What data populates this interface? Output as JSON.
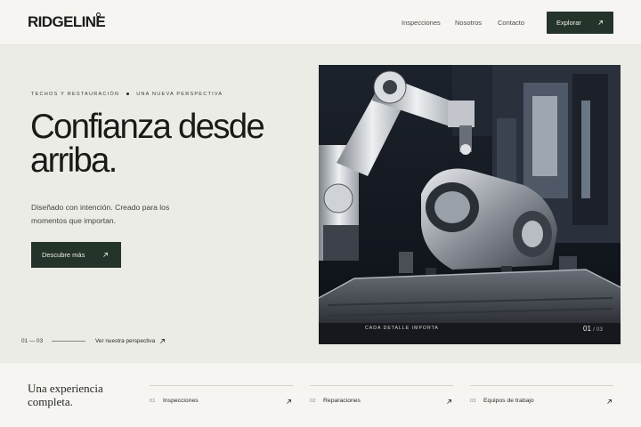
{
  "header": {
    "logo": "RIDGELINE",
    "nav": [
      "Inspecciones",
      "Nosotros",
      "Contacto"
    ],
    "cta_label": "Explorar"
  },
  "hero": {
    "eyebrow_left": "TECHOS Y RESTAURACIóN",
    "eyebrow_right": "UNA NUEVA PERSPECTIVA",
    "title": "Confianza desde arriba.",
    "subtitle": "Diseñado con intención. Creado para los momentos que importan.",
    "cta_label": "Descubre más",
    "counter": "01 — 03",
    "perspective_link": "Ver nuestra perspectiva"
  },
  "image_panel": {
    "caption": "CADA DETALLE IMPORTA",
    "slide_current": "01",
    "slide_total": "/ 03"
  },
  "footer": {
    "title": "Una experiencia completa.",
    "services": [
      {
        "num": "01",
        "label": "Inspecciones"
      },
      {
        "num": "02",
        "label": "Reparaciones"
      },
      {
        "num": "03",
        "label": "Equipos de trabajo"
      }
    ]
  },
  "colors": {
    "accent_dark_green": "#25342b",
    "page_background": "#ecece6",
    "header_background": "#f6f5f1"
  }
}
